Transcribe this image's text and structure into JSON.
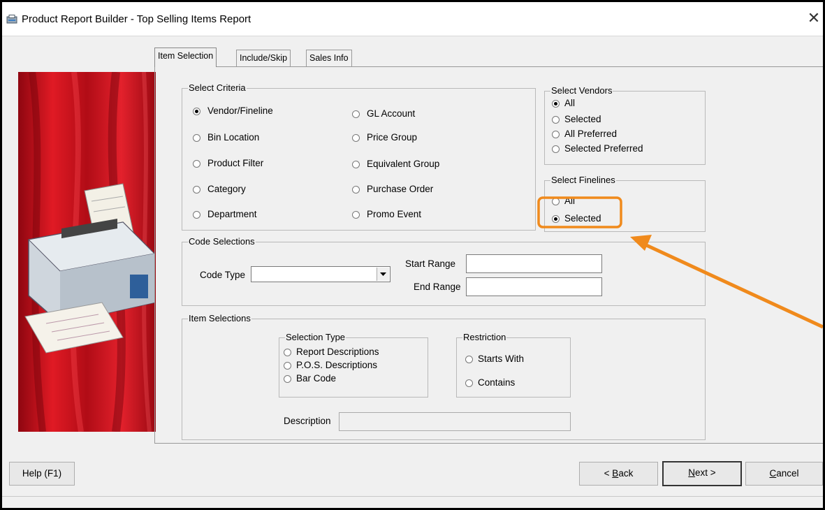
{
  "window": {
    "title": "Product Report Builder - Top Selling Items Report",
    "close_glyph": "✕"
  },
  "tabs": [
    {
      "label": "Item Selection",
      "active": true
    },
    {
      "label": "Include/Skip",
      "active": false
    },
    {
      "label": "Sales Info",
      "active": false
    }
  ],
  "select_criteria": {
    "title": "Select Criteria",
    "left": [
      {
        "label": "Vendor/Fineline",
        "checked": true
      },
      {
        "label": "Bin Location",
        "checked": false
      },
      {
        "label": "Product Filter",
        "checked": false
      },
      {
        "label": "Category",
        "checked": false
      },
      {
        "label": "Department",
        "checked": false
      }
    ],
    "right": [
      {
        "label": "GL Account",
        "checked": false
      },
      {
        "label": "Price Group",
        "checked": false
      },
      {
        "label": "Equivalent Group",
        "checked": false
      },
      {
        "label": "Purchase Order",
        "checked": false
      },
      {
        "label": "Promo Event",
        "checked": false
      }
    ]
  },
  "select_vendors": {
    "title": "Select Vendors",
    "options": [
      {
        "label": "All",
        "checked": true
      },
      {
        "label": "Selected",
        "checked": false
      },
      {
        "label": "All Preferred",
        "checked": false
      },
      {
        "label": "Selected Preferred",
        "checked": false
      }
    ]
  },
  "select_finelines": {
    "title": "Select Finelines",
    "options": [
      {
        "label": "All",
        "checked": false
      },
      {
        "label": "Selected",
        "checked": true
      }
    ]
  },
  "code_selections": {
    "title": "Code Selections",
    "code_type_label": "Code Type",
    "code_type_value": "",
    "start_range_label": "Start Range",
    "start_range_value": "",
    "end_range_label": "End Range",
    "end_range_value": ""
  },
  "item_selections": {
    "title": "Item Selections",
    "selection_type": {
      "title": "Selection Type",
      "options": [
        {
          "label": "Report Descriptions",
          "checked": false
        },
        {
          "label": "P.O.S. Descriptions",
          "checked": false
        },
        {
          "label": "Bar Code",
          "checked": false
        }
      ]
    },
    "restriction": {
      "title": "Restriction",
      "options": [
        {
          "label": "Starts With",
          "checked": false
        },
        {
          "label": "Contains",
          "checked": false
        }
      ]
    },
    "description_label": "Description",
    "description_value": ""
  },
  "buttons": {
    "help": "Help (F1)",
    "back_prefix": "< ",
    "back_hotkey": "B",
    "back_rest": "ack",
    "next_hotkey": "N",
    "next_rest": "ext >",
    "cancel_hotkey": "C",
    "cancel_rest": "ancel"
  },
  "colors": {
    "highlight": "#f08a1c",
    "hero_red": "#c8101b"
  },
  "icons": {
    "app": "report-builder-icon",
    "close": "close-icon",
    "hero": "printer-illustration",
    "dropdown": "chevron-down-icon"
  }
}
